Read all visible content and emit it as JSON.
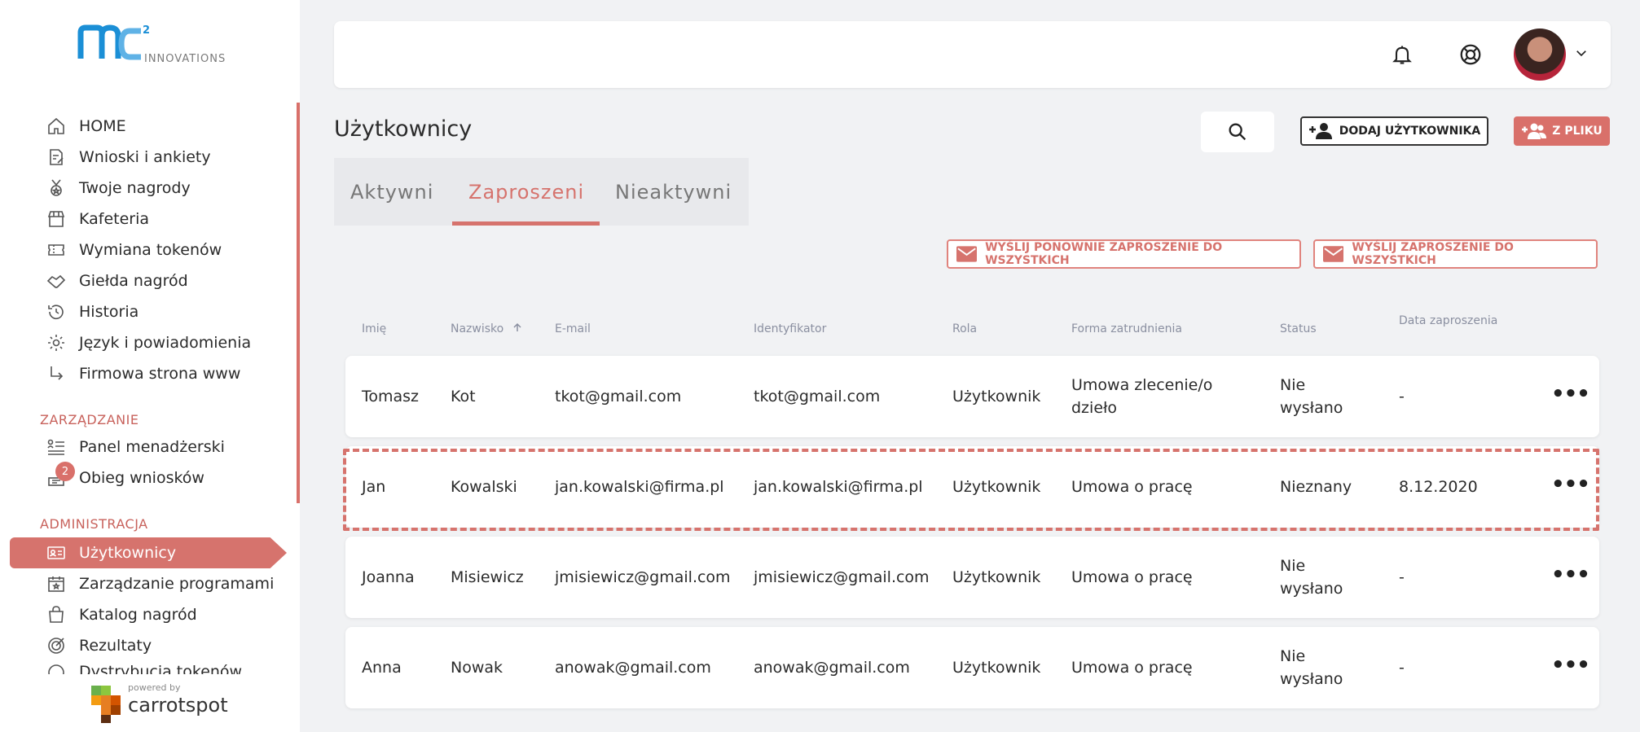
{
  "brand": {
    "logo_sup": "2",
    "logo_text": "INNOVATIONS",
    "powered_by": "powered by",
    "powered_brand": "carrotspot",
    "accent": "#d6736d",
    "logo_blue": "#1b8fd6"
  },
  "sidebar": {
    "items": [
      {
        "label": "HOME",
        "icon": "home-icon"
      },
      {
        "label": "Wnioski i ankiety",
        "icon": "form-edit-icon"
      },
      {
        "label": "Twoje nagrody",
        "icon": "medal-icon"
      },
      {
        "label": "Kafeteria",
        "icon": "store-icon"
      },
      {
        "label": "Wymiana tokenów",
        "icon": "ticket-icon"
      },
      {
        "label": "Giełda nagród",
        "icon": "handshake-icon"
      },
      {
        "label": "Historia",
        "icon": "history-icon"
      },
      {
        "label": "Język i powiadomienia",
        "icon": "gear-icon"
      },
      {
        "label": "Firmowa strona www",
        "icon": "arrow-return-icon"
      }
    ],
    "section_management": "ZARZĄDZANIE",
    "management_items": [
      {
        "label": "Panel menadżerski",
        "icon": "list-user-icon"
      },
      {
        "label": "Obieg wniosków",
        "icon": "workflow-icon",
        "badge": "2"
      }
    ],
    "section_admin": "ADMINISTRACJA",
    "admin_items": [
      {
        "label": "Użytkownicy",
        "icon": "id-card-icon",
        "active": true
      },
      {
        "label": "Zarządzanie programami",
        "icon": "calendar-star-icon"
      },
      {
        "label": "Katalog nagród",
        "icon": "bag-icon"
      },
      {
        "label": "Rezultaty",
        "icon": "target-icon"
      },
      {
        "label": "Dystrybucja tokenów",
        "icon": "distribution-icon"
      }
    ]
  },
  "topbar": {
    "icons": [
      "bell-icon",
      "support-icon",
      "avatar",
      "chevron-down-icon"
    ]
  },
  "page": {
    "title": "Użytkownicy",
    "add_user_label": "DODAJ UŻYTKOWNIKA",
    "from_file_label": "Z PLIKU",
    "tabs": [
      "Aktywni",
      "Zaproszeni",
      "Nieaktywni"
    ],
    "active_tab": "Zaproszeni",
    "resend_all_label": "WYŚLIJ PONOWNIE ZAPROSZENIE DO WSZYSTKICH",
    "send_all_label": "WYŚLIJ ZAPROSZENIE DO WSZYSTKICH"
  },
  "table": {
    "columns": [
      "Imię",
      "Nazwisko",
      "E-mail",
      "Identyfikator",
      "Rola",
      "Forma zatrudnienia",
      "Status",
      "Data zaproszenia"
    ],
    "sort_column": "Nazwisko",
    "rows": [
      {
        "first": "Tomasz",
        "last": "Kot",
        "email": "tkot@gmail.com",
        "id": "tkot@gmail.com",
        "role": "Użytkownik",
        "form_1": "Umowa zlecenie/o",
        "form_2": "dzieło",
        "status_1": "Nie",
        "status_2": "wysłano",
        "date": "-"
      },
      {
        "first": "Jan",
        "last": "Kowalski",
        "email": "jan.kowalski@firma.pl",
        "id": "jan.kowalski@firma.pl",
        "role": "Użytkownik",
        "form_1": "Umowa o pracę",
        "form_2": "",
        "status_1": "Nieznany",
        "status_2": "",
        "date": "8.12.2020"
      },
      {
        "first": "Joanna",
        "last": "Misiewicz",
        "email": "jmisiewicz@gmail.com",
        "id": "jmisiewicz@gmail.com",
        "role": "Użytkownik",
        "form_1": "Umowa o pracę",
        "form_2": "",
        "status_1": "Nie",
        "status_2": "wysłano",
        "date": "-"
      },
      {
        "first": "Anna",
        "last": "Nowak",
        "email": "anowak@gmail.com",
        "id": "anowak@gmail.com",
        "role": "Użytkownik",
        "form_1": "Umowa o pracę",
        "form_2": "",
        "status_1": "Nie",
        "status_2": "wysłano",
        "date": "-"
      }
    ],
    "more_glyph": "•••"
  }
}
